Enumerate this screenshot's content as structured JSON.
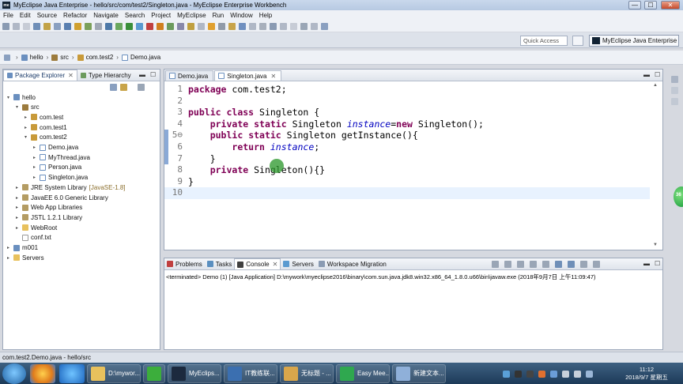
{
  "window": {
    "title": "MyEclipse Java Enterprise - hello/src/com/test2/Singleton.java - MyEclipse Enterprise Workbench",
    "app_icon_text": "me",
    "controls": {
      "minimize": "—",
      "maximize": "☐",
      "close": "✕"
    }
  },
  "menubar": [
    "File",
    "Edit",
    "Source",
    "Refactor",
    "Navigate",
    "Search",
    "Project",
    "MyEclipse",
    "Run",
    "Window",
    "Help"
  ],
  "quick": {
    "quick_access": "Quick Access",
    "perspective": "MyEclipse Java Enterprise"
  },
  "breadcrumb": [
    {
      "label": "hello",
      "icon": "project-icon"
    },
    {
      "label": "src",
      "icon": "source-folder-icon"
    },
    {
      "label": "com.test2",
      "icon": "package-icon"
    },
    {
      "label": "Demo.java",
      "icon": "java-file-icon"
    }
  ],
  "package_explorer": {
    "tabs": [
      "Package Explorer",
      "Type Hierarchy"
    ],
    "tree": [
      {
        "label": "hello",
        "indent": 0,
        "twisty": "▾",
        "icon": "proj"
      },
      {
        "label": "src",
        "indent": 1,
        "twisty": "▾",
        "icon": "src"
      },
      {
        "label": "com.test",
        "indent": 2,
        "twisty": "▸",
        "icon": "pkg"
      },
      {
        "label": "com.test1",
        "indent": 2,
        "twisty": "▸",
        "icon": "pkg"
      },
      {
        "label": "com.test2",
        "indent": 2,
        "twisty": "▾",
        "icon": "pkg"
      },
      {
        "label": "Demo.java",
        "indent": 3,
        "twisty": "▸",
        "icon": "java"
      },
      {
        "label": "MyThread.java",
        "indent": 3,
        "twisty": "▸",
        "icon": "java"
      },
      {
        "label": "Person.java",
        "indent": 3,
        "twisty": "▸",
        "icon": "java"
      },
      {
        "label": "Singleton.java",
        "indent": 3,
        "twisty": "▸",
        "icon": "java"
      },
      {
        "label": "JRE System Library",
        "suffix": "[JavaSE-1.8]",
        "indent": 1,
        "twisty": "▸",
        "icon": "lib"
      },
      {
        "label": "JavaEE 6.0 Generic Library",
        "indent": 1,
        "twisty": "▸",
        "icon": "lib"
      },
      {
        "label": "Web App Libraries",
        "indent": 1,
        "twisty": "▸",
        "icon": "lib"
      },
      {
        "label": "JSTL 1.2.1 Library",
        "indent": 1,
        "twisty": "▸",
        "icon": "lib"
      },
      {
        "label": "WebRoot",
        "indent": 1,
        "twisty": "▸",
        "icon": "folder"
      },
      {
        "label": "conf.txt",
        "indent": 1,
        "twisty": "",
        "icon": "file"
      },
      {
        "label": "m001",
        "indent": 0,
        "twisty": "▸",
        "icon": "proj"
      },
      {
        "label": "Servers",
        "indent": 0,
        "twisty": "▸",
        "icon": "folder"
      }
    ]
  },
  "editor": {
    "tabs": [
      "Demo.java",
      "Singleton.java"
    ],
    "active_tab": "Singleton.java",
    "line_numbers": [
      "1",
      "2",
      "3",
      "4",
      "5⊖",
      "6",
      "7",
      "8",
      "9",
      "10"
    ],
    "lines": [
      "<span class='kw'>package</span> com.test2;",
      "",
      "<span class='kw'>public</span> <span class='kw'>class</span> Singleton {",
      "    <span class='kw'>private</span> <span class='kw'>static</span> Singleton <span class='fld'>instance</span>=<span class='kw'>new</span> Singleton();",
      "    <span class='kw'>public</span> <span class='kw'>static</span> Singleton getInstance(){",
      "        <span class='kw'>return</span> <span class='fld'>instance</span>;",
      "    }",
      "    <span class='kw'>private</span> Singleton(){}",
      "}",
      ""
    ]
  },
  "console": {
    "tabs": [
      "Problems",
      "Tasks",
      "Console",
      "Servers",
      "Workspace Migration"
    ],
    "active_tab": "Console",
    "text": "<terminated> Demo (1) [Java Application] D:\\mywork\\myeclipse2016\\binary\\com.sun.java.jdk8.win32.x86_64_1.8.0.u66\\bin\\javaw.exe (2018年9月7日 上午11:09:47)"
  },
  "status": {
    "text": "com.test2.Demo.java - hello/src"
  },
  "green_ball_text": "36",
  "taskbar": {
    "items": [
      {
        "label": "D:\\mywor...",
        "color": "#e8c15d"
      },
      {
        "label": "",
        "color": "#3cae3c"
      },
      {
        "label": "MyEclips...",
        "color": "#1c2a3e"
      },
      {
        "label": "IT教练联...",
        "color": "#3b6fb0"
      },
      {
        "label": "无标题 - ...",
        "color": "#d9a64b"
      },
      {
        "label": "Easy Mee...",
        "color": "#2fa84f"
      },
      {
        "label": "新建文本...",
        "color": "#8fb0d9"
      }
    ],
    "clock_time": "11:12",
    "clock_date": "2018/9/7 星期五"
  },
  "colors": {
    "keyword": "#7f0055",
    "field": "#0000c0",
    "current_line": "#e8f2fe",
    "taskbar": "#1d3a58"
  }
}
